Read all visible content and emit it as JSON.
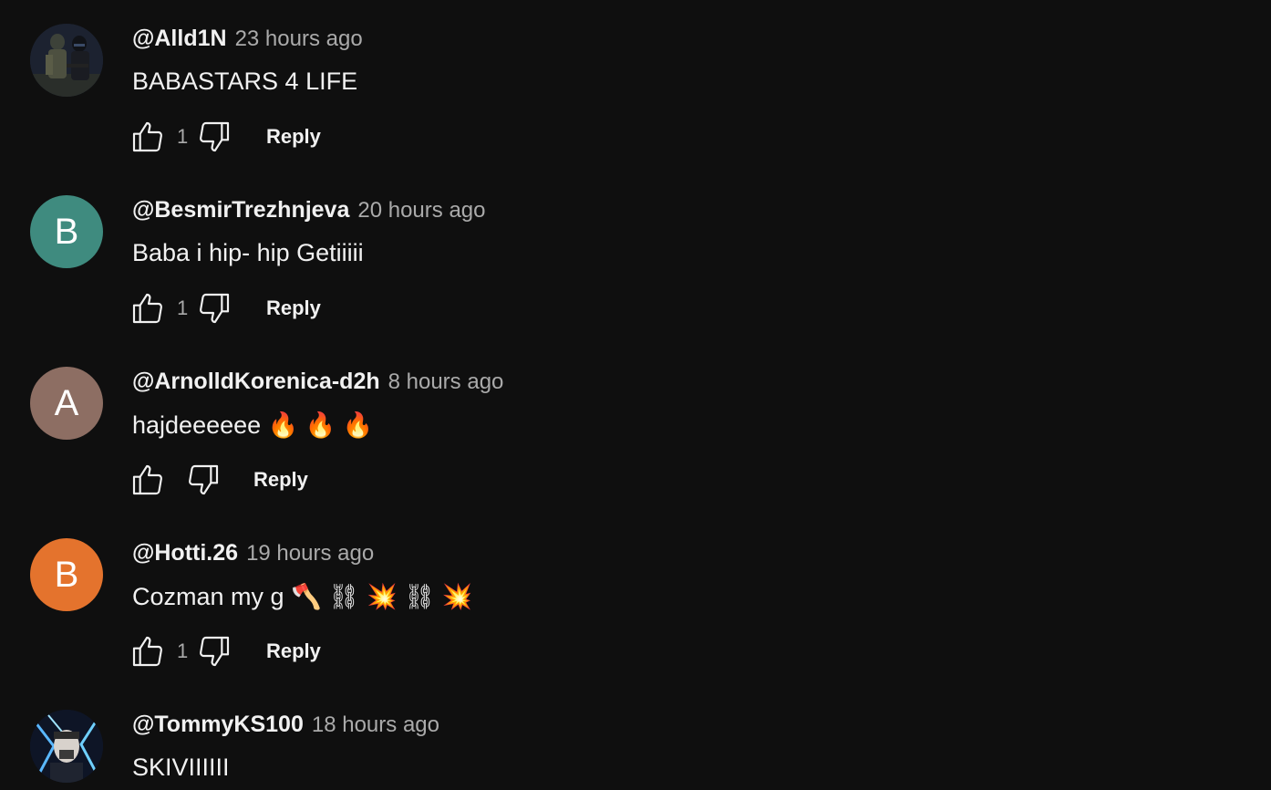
{
  "comments": [
    {
      "author": "@Alld1N",
      "time": "23 hours ago",
      "text": "BABASTARS 4 LIFE",
      "likes": "1",
      "reply_label": "Reply",
      "avatar": {
        "type": "image",
        "icon": "soldiers-photo-avatar"
      }
    },
    {
      "author": "@BesmirTrezhnjeva",
      "time": "20 hours ago",
      "text": "Baba i hip- hip Getiiiii",
      "likes": "1",
      "reply_label": "Reply",
      "avatar": {
        "type": "letter",
        "letter": "B",
        "color": "#3f8b7f"
      }
    },
    {
      "author": "@ArnolldKorenica-d2h",
      "time": "8 hours ago",
      "text": "hajdeeeeee 🔥 🔥 🔥",
      "likes": "",
      "reply_label": "Reply",
      "avatar": {
        "type": "letter",
        "letter": "A",
        "color": "#8d6e63"
      }
    },
    {
      "author": "@Hotti.26",
      "time": "19 hours ago",
      "text": "Cozman my g 🪓 ⛓ 💥 ⛓ 💥",
      "likes": "1",
      "reply_label": "Reply",
      "avatar": {
        "type": "letter",
        "letter": "B",
        "color": "#e4732d"
      }
    },
    {
      "author": "@TommyKS100",
      "time": "18 hours ago",
      "text": "SKIVIIIIII",
      "likes": "",
      "reply_label": "",
      "avatar": {
        "type": "image",
        "icon": "neon-portrait-avatar"
      }
    }
  ],
  "colors": {
    "background": "#0f0f0f",
    "primary_text": "#f1f1f1",
    "secondary_text": "#aaaaaa"
  }
}
